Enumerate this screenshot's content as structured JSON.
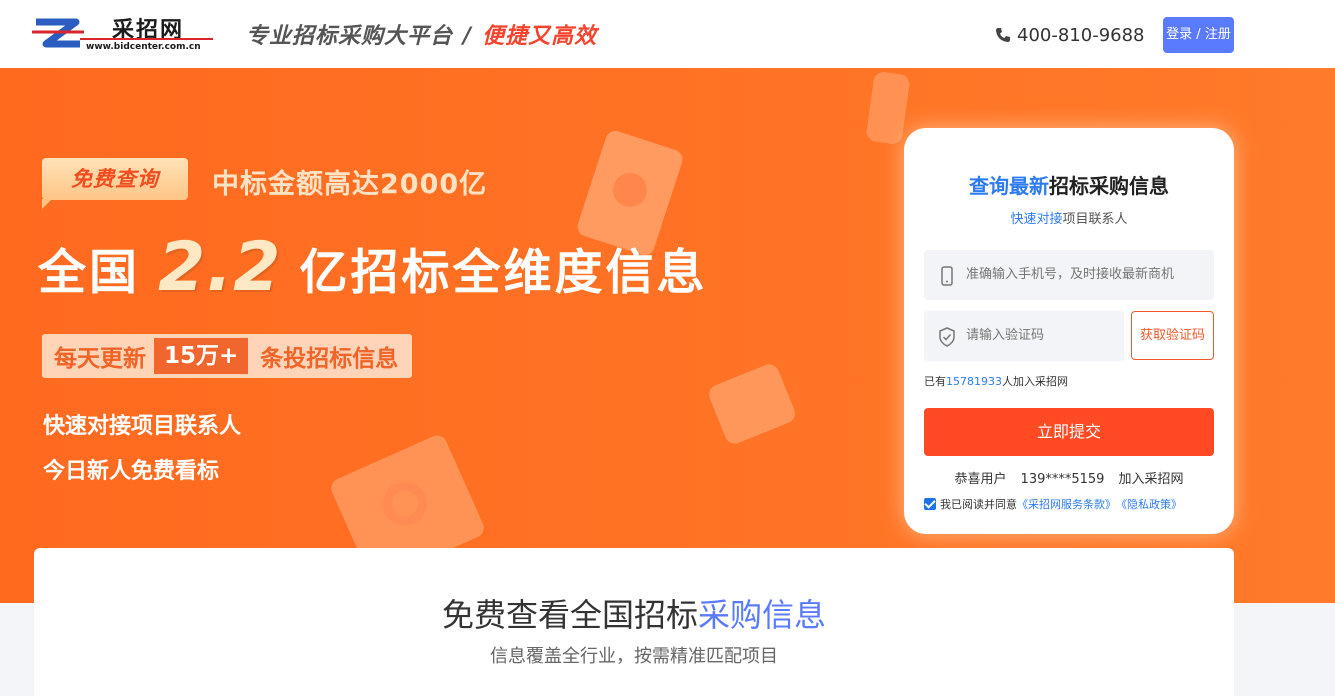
{
  "header": {
    "logo_name": "采招网",
    "logo_url": "www.bidcenter.com.cn",
    "slogan_main": "专业招标采购大平台",
    "slogan_sep": "/",
    "slogan_accent": "便捷又高效",
    "phone": "400-810-9688",
    "login_label": "登录 / 注册"
  },
  "banner": {
    "tag_free": "免费查询",
    "bid_amount": "中标金额高达2000亿",
    "headline_prefix": "全国",
    "headline_number": "2.2",
    "headline_suffix": "亿招标全维度信息",
    "daily_prefix": "每天更新",
    "daily_count": "15万+",
    "daily_suffix": "条投招标信息",
    "feature_1": "快速对接项目联系人",
    "feature_2": "今日新人免费看标"
  },
  "form": {
    "title_highlight": "查询最新",
    "title_rest": "招标采购信息",
    "subtitle_highlight": "快速对接",
    "subtitle_rest": "项目联系人",
    "phone_placeholder": "准确输入手机号，及时接收最新商机",
    "code_placeholder": "请输入验证码",
    "get_code_label": "获取验证码",
    "joined_prefix": "已有",
    "joined_count": "15781933",
    "joined_suffix": "人加入采招网",
    "submit_label": "立即提交",
    "congrats_prefix": "恭喜用户",
    "congrats_user": "139****5159",
    "congrats_suffix": "加入采招网",
    "agree_prefix": "我已阅读并同意",
    "terms_link": "《采招网服务条款》",
    "privacy_link": "《隐私政策》",
    "agree_checked": true
  },
  "section": {
    "title_prefix": "免费查看全国招标",
    "title_highlight": "采购信息",
    "subtitle": "信息覆盖全行业，按需精准匹配项目"
  },
  "colors": {
    "banner_orange": "#ff6a1f",
    "accent_blue": "#2d7bf0",
    "login_blue": "#5b7bff",
    "submit_red": "#ff4a24"
  }
}
